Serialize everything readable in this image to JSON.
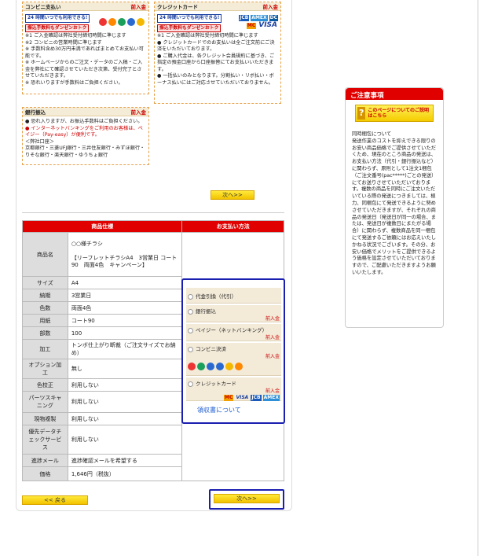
{
  "conveni": {
    "title": "コンビニ支払い",
    "fee": "前入金",
    "tag1": "24 時間いつでも利用できる!",
    "tag2": "振込手数料もダンゼンおトク",
    "notes": [
      "※1 ご入金確認は弊社受付締切時間に準じます",
      "※2 コンビニの営業時間に準じます",
      "※ 手数料含め30万円未満であればまとめてお支払い可能です。",
      "※ ホームページからのご注文・データのご入稿・ご入金を弊社にて確認させていただき次第、受付完了とさせていただきます。",
      "※ 恐れいりますが手数料はご負担ください。"
    ]
  },
  "credit": {
    "title": "クレジットカード",
    "fee": "前入金",
    "tag1": "24 時間いつでも利用できる!",
    "tag2": "振込手数料もダンゼンおトク",
    "brands": [
      "JCB",
      "AMEX",
      "DC",
      "MC",
      "VISA"
    ],
    "notes": [
      "※1 ご入金確認は弊社受付締切時間に準じます",
      "● クレジットカードでのお支払いは全ご注文前にご決済をいただいております。",
      "● ご購入代金は、各クレジット会員規約に基づき、ご指定の預金口座から口座振替にてお支払いいただきます。",
      "● 一括払いのみとなります。分割払い・リボ払い・ボーナス払いにはご対応させていただいておりません。"
    ]
  },
  "bank": {
    "title": "銀行振込",
    "fee": "前入金",
    "lines": [
      "● 恐れ入りますが、お振込手数料はご負担ください。"
    ],
    "red": "● インターネットバンキングをご利用のお客様は、ペイジー（Pay-easy）が便利です。",
    "account_title": "＜弊社口座＞",
    "accounts": "京都銀行・三菱UFJ銀行・三井住友銀行・みずほ銀行・りそな銀行・楽天銀行・ゆうちょ銀行"
  },
  "next_top": "次へ>>",
  "spec": {
    "header": "商品仕様",
    "rows": [
      {
        "label": "商品名",
        "value": "○○様チラシ\n\n【リーフレットチラシA4　3営業日 コート90　両面4色　キャンペーン】"
      },
      {
        "label": "サイズ",
        "value": "A4"
      },
      {
        "label": "納期",
        "value": "3営業日"
      },
      {
        "label": "色数",
        "value": "両面4色"
      },
      {
        "label": "用紙",
        "value": "コート90"
      },
      {
        "label": "部数",
        "value": "100"
      },
      {
        "label": "加工",
        "value": "トンボ仕上がり断裁（ご注文サイズでお納め）"
      },
      {
        "label": "オプション加工",
        "value": "無し"
      },
      {
        "label": "色校正",
        "value": "利用しない"
      },
      {
        "label": "パーツスキャニング",
        "value": "利用しない"
      },
      {
        "label": "現物複製",
        "value": "利用しない"
      },
      {
        "label": "優先データチェックサービス",
        "value": "利用しない"
      },
      {
        "label": "進捗メール",
        "value": "進捗確認メールを希望する"
      },
      {
        "label": "価格",
        "value": "1,646円（税抜）"
      }
    ]
  },
  "payment": {
    "header": "お支払い方法",
    "options": [
      {
        "label": "代金引換（代引）",
        "fee": ""
      },
      {
        "label": "銀行振込",
        "fee": "前入金"
      },
      {
        "label": "ペイジー（ネットバンキング）",
        "fee": "前入金"
      },
      {
        "label": "コンビニ決済",
        "fee": "前入金"
      },
      {
        "label": "クレジットカード",
        "fee": "前入金"
      }
    ],
    "receipt": "領収書について"
  },
  "back": "<< 戻る",
  "next_bottom": "次へ>>",
  "notice": {
    "title": "ご注意事項",
    "help": "このページについてのご説明はこちら",
    "body": "同時梱包について\n発送作業のコストを抑えできる限りのお安い商品価格でご提供させていただくため、現在のところ商品の発送は、お支払い方法（代引・銀行振込など）に関わらず、原則として1注文1梱包（ご注文番号(pac*****)ごとの発送）にてお送りさせていただいております。複数の商品を同時にご注文いただいている際の発送につきましては、極力、同梱包にて発送できるように努めさせていただきますが、それぞれの商品の発送日（発送日が同一の場合、または、発送日が複数日にまたがる場合）に関わらず、複数商品を同一梱包にて発送するご依頼にはお応えいたしかねる状況でございます。その分、お安い価格でメリットをご提供できるよう価格を設定させていただいておりますので、ご配慮いただきますようお願いいたします。"
  }
}
